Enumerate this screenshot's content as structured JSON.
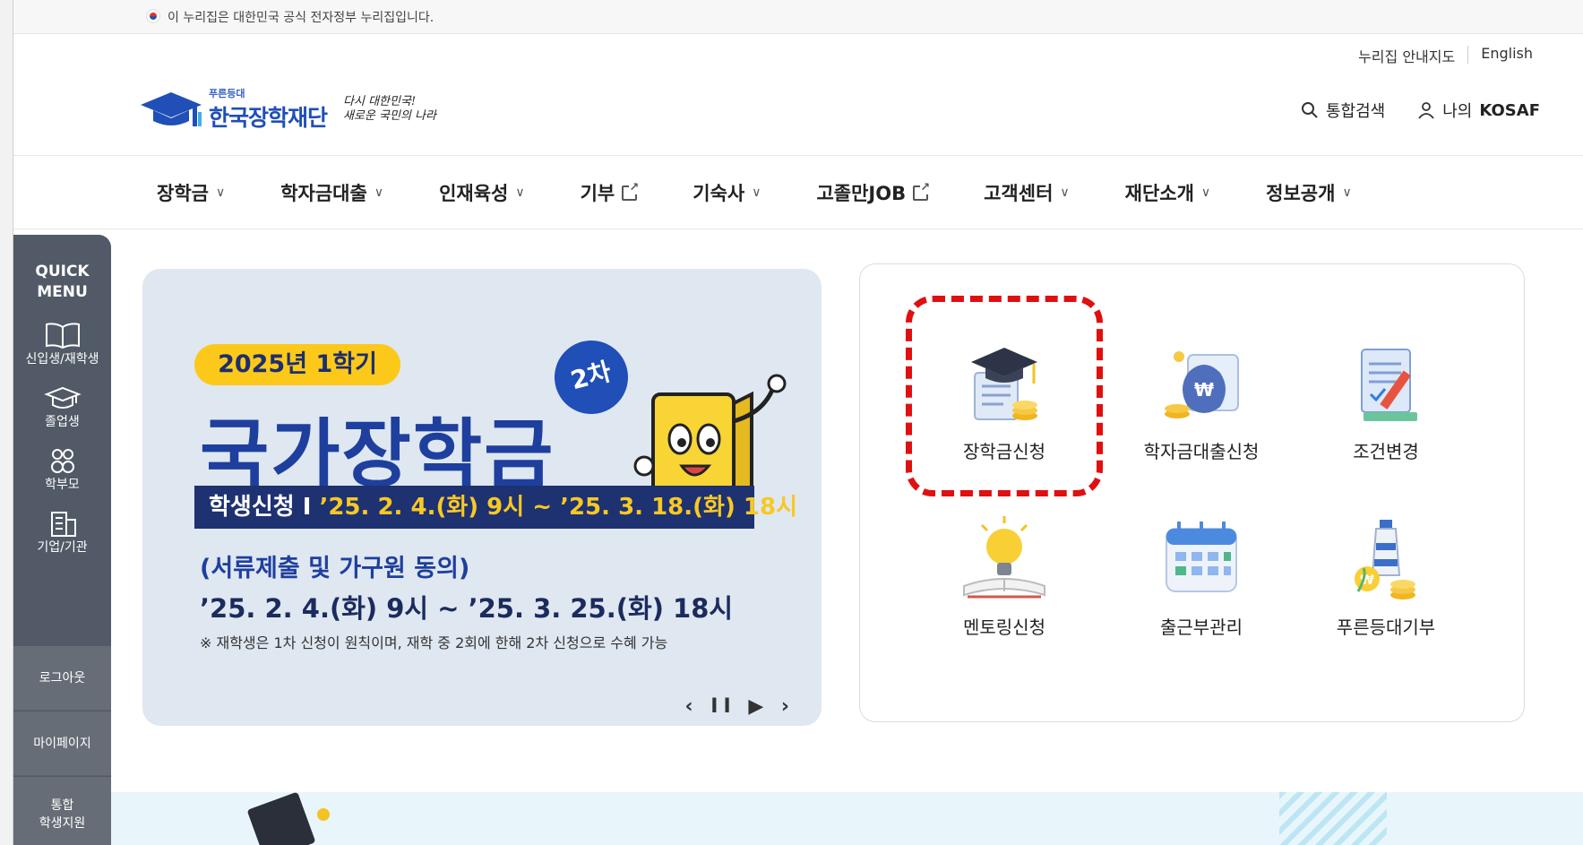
{
  "gov_banner": {
    "text": "이 누리집은 대한민국 공식 전자정부 누리집입니다."
  },
  "util_links": {
    "sitemap": "누리집 안내지도",
    "english": "English"
  },
  "logo": {
    "small": "푸른등대",
    "name": "한국장학재단",
    "slogan_line1": "다시 대한민국!",
    "slogan_line2": "새로운 국민의 나라"
  },
  "header_actions": {
    "search": "통합검색",
    "my_prefix": "나의",
    "my_brand": "KOSAF"
  },
  "nav": [
    {
      "label": "장학금",
      "type": "dropdown"
    },
    {
      "label": "학자금대출",
      "type": "dropdown"
    },
    {
      "label": "인재육성",
      "type": "dropdown"
    },
    {
      "label": "기부",
      "type": "external"
    },
    {
      "label": "기숙사",
      "type": "dropdown"
    },
    {
      "label": "고졸만JOB",
      "type": "external"
    },
    {
      "label": "고객센터",
      "type": "dropdown"
    },
    {
      "label": "재단소개",
      "type": "dropdown"
    },
    {
      "label": "정보공개",
      "type": "dropdown"
    }
  ],
  "quick_menu": {
    "title_line1": "QUICK",
    "title_line2": "MENU",
    "items": [
      "신입생/재학생",
      "졸업생",
      "학부모",
      "기업/기관"
    ],
    "logout": "로그아웃",
    "mypage": "마이페이지",
    "integrated_line1": "통합",
    "integrated_line2": "학생지원"
  },
  "banner": {
    "term": "2025년 1학기",
    "title": "국가장학금",
    "round_badge": "2차",
    "period_label": "학생신청 I ",
    "period": "’25. 2. 4.(화) 9시 ~ ’25. 3. 18.(화) 18시",
    "docs_label": "(서류제출 및 가구원 동의)",
    "docs_period": "’25. 2. 4.(화) 9시 ~ ’25. 3. 25.(화) 18시",
    "note": "※ 재학생은 1차 신청이 원칙이며, 재학 중 2회에 한해 2차 신청으로 수혜 가능",
    "controls": {
      "prev": "‹",
      "pause": "II",
      "play": "▶",
      "next": "›"
    }
  },
  "services": [
    {
      "label": "장학금신청",
      "icon": "scholarship-icon"
    },
    {
      "label": "학자금대출신청",
      "icon": "loan-icon"
    },
    {
      "label": "조건변경",
      "icon": "document-edit-icon"
    },
    {
      "label": "멘토링신청",
      "icon": "lightbulb-book-icon"
    },
    {
      "label": "출근부관리",
      "icon": "calendar-icon"
    },
    {
      "label": "푸른등대기부",
      "icon": "lighthouse-icon"
    }
  ],
  "colors": {
    "brand": "#1f4fb7",
    "navy": "#1e3171",
    "yellow": "#fcc91a",
    "highlight": "#e01010",
    "quick_bg": "#515a66"
  }
}
